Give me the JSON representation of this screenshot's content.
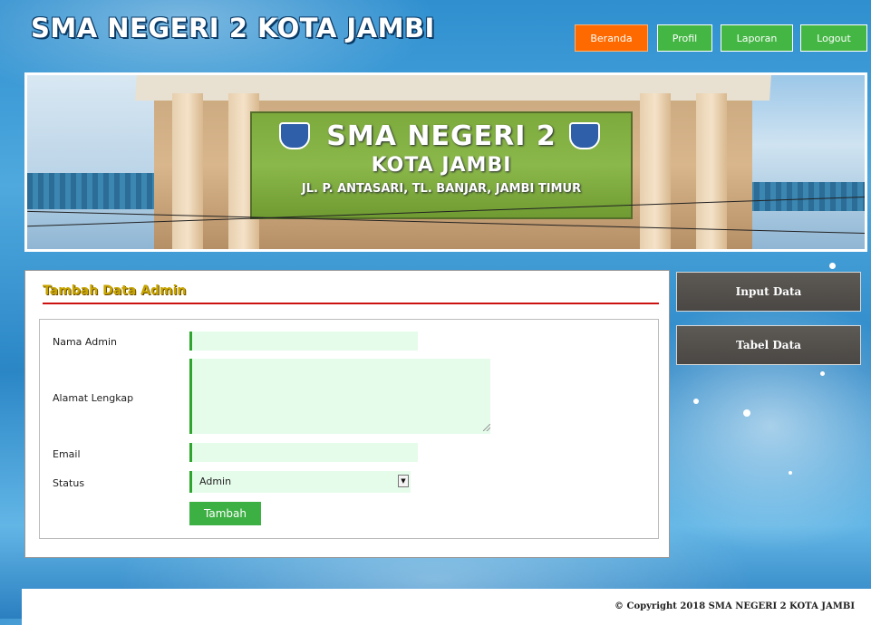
{
  "site": {
    "title": "SMA NEGERI 2 KOTA JAMBI"
  },
  "nav": {
    "items": [
      {
        "label": "Beranda",
        "color": "#ff6a00"
      },
      {
        "label": "Profil",
        "color": "#43b643"
      },
      {
        "label": "Laporan",
        "color": "#43b643"
      },
      {
        "label": "Logout",
        "color": "#43b643"
      }
    ]
  },
  "banner": {
    "sign_line1": "SMA NEGERI 2",
    "sign_line2": "KOTA JAMBI",
    "sign_line3": "JL. P. ANTASARI, TL. BANJAR, JAMBI TIMUR"
  },
  "content": {
    "heading": "Tambah Data Admin",
    "form": {
      "nama_label": "Nama Admin",
      "nama_value": "",
      "alamat_label": "Alamat Lengkap",
      "alamat_value": "",
      "email_label": "Email",
      "email_value": "",
      "status_label": "Status",
      "status_value": "Admin",
      "submit_label": "Tambah"
    }
  },
  "sidebar": {
    "items": [
      {
        "label": "Input Data"
      },
      {
        "label": "Tabel Data"
      }
    ]
  },
  "footer": {
    "copyright": "© Copyright 2018 SMA NEGERI 2 KOTA JAMBI"
  },
  "colors": {
    "accent_green": "#3cb043",
    "heading_gold": "#c8a500",
    "rule_red": "#cc1111"
  }
}
